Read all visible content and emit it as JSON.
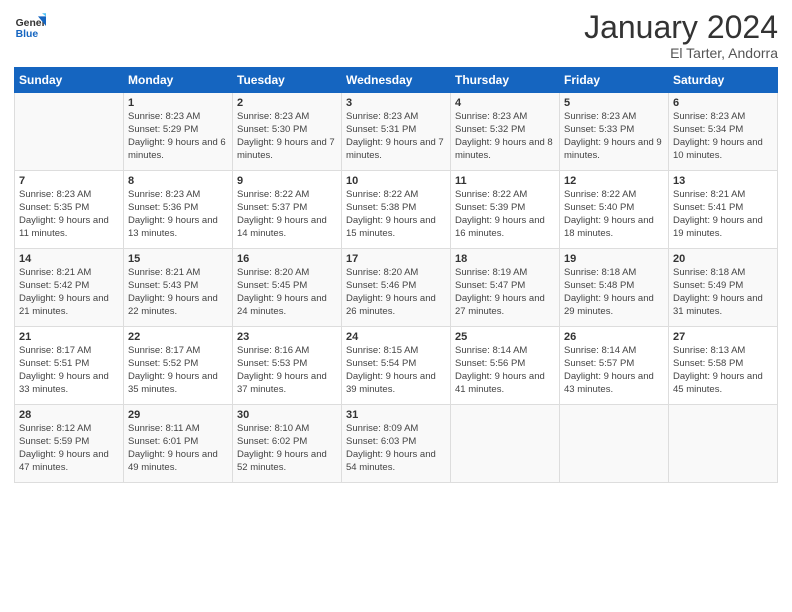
{
  "logo": {
    "text_general": "General",
    "text_blue": "Blue"
  },
  "header": {
    "month_title": "January 2024",
    "subtitle": "El Tarter, Andorra"
  },
  "days_of_week": [
    "Sunday",
    "Monday",
    "Tuesday",
    "Wednesday",
    "Thursday",
    "Friday",
    "Saturday"
  ],
  "weeks": [
    [
      {
        "num": "",
        "sunrise": "",
        "sunset": "",
        "daylight": ""
      },
      {
        "num": "1",
        "sunrise": "Sunrise: 8:23 AM",
        "sunset": "Sunset: 5:29 PM",
        "daylight": "Daylight: 9 hours and 6 minutes."
      },
      {
        "num": "2",
        "sunrise": "Sunrise: 8:23 AM",
        "sunset": "Sunset: 5:30 PM",
        "daylight": "Daylight: 9 hours and 7 minutes."
      },
      {
        "num": "3",
        "sunrise": "Sunrise: 8:23 AM",
        "sunset": "Sunset: 5:31 PM",
        "daylight": "Daylight: 9 hours and 7 minutes."
      },
      {
        "num": "4",
        "sunrise": "Sunrise: 8:23 AM",
        "sunset": "Sunset: 5:32 PM",
        "daylight": "Daylight: 9 hours and 8 minutes."
      },
      {
        "num": "5",
        "sunrise": "Sunrise: 8:23 AM",
        "sunset": "Sunset: 5:33 PM",
        "daylight": "Daylight: 9 hours and 9 minutes."
      },
      {
        "num": "6",
        "sunrise": "Sunrise: 8:23 AM",
        "sunset": "Sunset: 5:34 PM",
        "daylight": "Daylight: 9 hours and 10 minutes."
      }
    ],
    [
      {
        "num": "7",
        "sunrise": "Sunrise: 8:23 AM",
        "sunset": "Sunset: 5:35 PM",
        "daylight": "Daylight: 9 hours and 11 minutes."
      },
      {
        "num": "8",
        "sunrise": "Sunrise: 8:23 AM",
        "sunset": "Sunset: 5:36 PM",
        "daylight": "Daylight: 9 hours and 13 minutes."
      },
      {
        "num": "9",
        "sunrise": "Sunrise: 8:22 AM",
        "sunset": "Sunset: 5:37 PM",
        "daylight": "Daylight: 9 hours and 14 minutes."
      },
      {
        "num": "10",
        "sunrise": "Sunrise: 8:22 AM",
        "sunset": "Sunset: 5:38 PM",
        "daylight": "Daylight: 9 hours and 15 minutes."
      },
      {
        "num": "11",
        "sunrise": "Sunrise: 8:22 AM",
        "sunset": "Sunset: 5:39 PM",
        "daylight": "Daylight: 9 hours and 16 minutes."
      },
      {
        "num": "12",
        "sunrise": "Sunrise: 8:22 AM",
        "sunset": "Sunset: 5:40 PM",
        "daylight": "Daylight: 9 hours and 18 minutes."
      },
      {
        "num": "13",
        "sunrise": "Sunrise: 8:21 AM",
        "sunset": "Sunset: 5:41 PM",
        "daylight": "Daylight: 9 hours and 19 minutes."
      }
    ],
    [
      {
        "num": "14",
        "sunrise": "Sunrise: 8:21 AM",
        "sunset": "Sunset: 5:42 PM",
        "daylight": "Daylight: 9 hours and 21 minutes."
      },
      {
        "num": "15",
        "sunrise": "Sunrise: 8:21 AM",
        "sunset": "Sunset: 5:43 PM",
        "daylight": "Daylight: 9 hours and 22 minutes."
      },
      {
        "num": "16",
        "sunrise": "Sunrise: 8:20 AM",
        "sunset": "Sunset: 5:45 PM",
        "daylight": "Daylight: 9 hours and 24 minutes."
      },
      {
        "num": "17",
        "sunrise": "Sunrise: 8:20 AM",
        "sunset": "Sunset: 5:46 PM",
        "daylight": "Daylight: 9 hours and 26 minutes."
      },
      {
        "num": "18",
        "sunrise": "Sunrise: 8:19 AM",
        "sunset": "Sunset: 5:47 PM",
        "daylight": "Daylight: 9 hours and 27 minutes."
      },
      {
        "num": "19",
        "sunrise": "Sunrise: 8:18 AM",
        "sunset": "Sunset: 5:48 PM",
        "daylight": "Daylight: 9 hours and 29 minutes."
      },
      {
        "num": "20",
        "sunrise": "Sunrise: 8:18 AM",
        "sunset": "Sunset: 5:49 PM",
        "daylight": "Daylight: 9 hours and 31 minutes."
      }
    ],
    [
      {
        "num": "21",
        "sunrise": "Sunrise: 8:17 AM",
        "sunset": "Sunset: 5:51 PM",
        "daylight": "Daylight: 9 hours and 33 minutes."
      },
      {
        "num": "22",
        "sunrise": "Sunrise: 8:17 AM",
        "sunset": "Sunset: 5:52 PM",
        "daylight": "Daylight: 9 hours and 35 minutes."
      },
      {
        "num": "23",
        "sunrise": "Sunrise: 8:16 AM",
        "sunset": "Sunset: 5:53 PM",
        "daylight": "Daylight: 9 hours and 37 minutes."
      },
      {
        "num": "24",
        "sunrise": "Sunrise: 8:15 AM",
        "sunset": "Sunset: 5:54 PM",
        "daylight": "Daylight: 9 hours and 39 minutes."
      },
      {
        "num": "25",
        "sunrise": "Sunrise: 8:14 AM",
        "sunset": "Sunset: 5:56 PM",
        "daylight": "Daylight: 9 hours and 41 minutes."
      },
      {
        "num": "26",
        "sunrise": "Sunrise: 8:14 AM",
        "sunset": "Sunset: 5:57 PM",
        "daylight": "Daylight: 9 hours and 43 minutes."
      },
      {
        "num": "27",
        "sunrise": "Sunrise: 8:13 AM",
        "sunset": "Sunset: 5:58 PM",
        "daylight": "Daylight: 9 hours and 45 minutes."
      }
    ],
    [
      {
        "num": "28",
        "sunrise": "Sunrise: 8:12 AM",
        "sunset": "Sunset: 5:59 PM",
        "daylight": "Daylight: 9 hours and 47 minutes."
      },
      {
        "num": "29",
        "sunrise": "Sunrise: 8:11 AM",
        "sunset": "Sunset: 6:01 PM",
        "daylight": "Daylight: 9 hours and 49 minutes."
      },
      {
        "num": "30",
        "sunrise": "Sunrise: 8:10 AM",
        "sunset": "Sunset: 6:02 PM",
        "daylight": "Daylight: 9 hours and 52 minutes."
      },
      {
        "num": "31",
        "sunrise": "Sunrise: 8:09 AM",
        "sunset": "Sunset: 6:03 PM",
        "daylight": "Daylight: 9 hours and 54 minutes."
      },
      {
        "num": "",
        "sunrise": "",
        "sunset": "",
        "daylight": ""
      },
      {
        "num": "",
        "sunrise": "",
        "sunset": "",
        "daylight": ""
      },
      {
        "num": "",
        "sunrise": "",
        "sunset": "",
        "daylight": ""
      }
    ]
  ]
}
